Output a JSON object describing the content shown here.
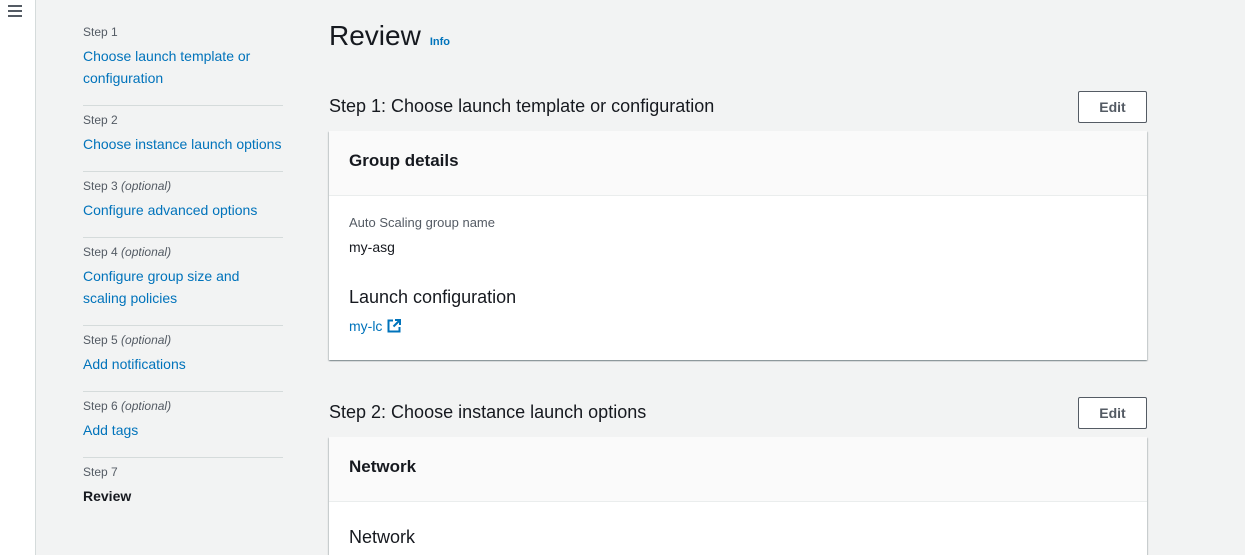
{
  "nav": {
    "menu_icon": "hamburger-menu-icon"
  },
  "steps": [
    {
      "num": "Step 1",
      "optional": "",
      "label": "Choose launch template or configuration"
    },
    {
      "num": "Step 2",
      "optional": "",
      "label": "Choose instance launch options"
    },
    {
      "num": "Step 3",
      "optional": "(optional)",
      "label": "Configure advanced options"
    },
    {
      "num": "Step 4",
      "optional": "(optional)",
      "label": "Configure group size and scaling policies"
    },
    {
      "num": "Step 5",
      "optional": "(optional)",
      "label": "Add notifications"
    },
    {
      "num": "Step 6",
      "optional": "(optional)",
      "label": "Add tags"
    },
    {
      "num": "Step 7",
      "optional": "",
      "label": "Review"
    }
  ],
  "page": {
    "title": "Review",
    "info": "Info"
  },
  "sections": [
    {
      "title": "Step 1: Choose launch template or configuration",
      "edit": "Edit",
      "card_title": "Group details",
      "asg_label": "Auto Scaling group name",
      "asg_value": "my-asg",
      "lc_heading": "Launch configuration",
      "lc_link": "my-lc",
      "lc_icon": "external-link-icon"
    },
    {
      "title": "Step 2: Choose instance launch options",
      "edit": "Edit",
      "card_title": "Network",
      "sub_heading": "Network"
    }
  ]
}
